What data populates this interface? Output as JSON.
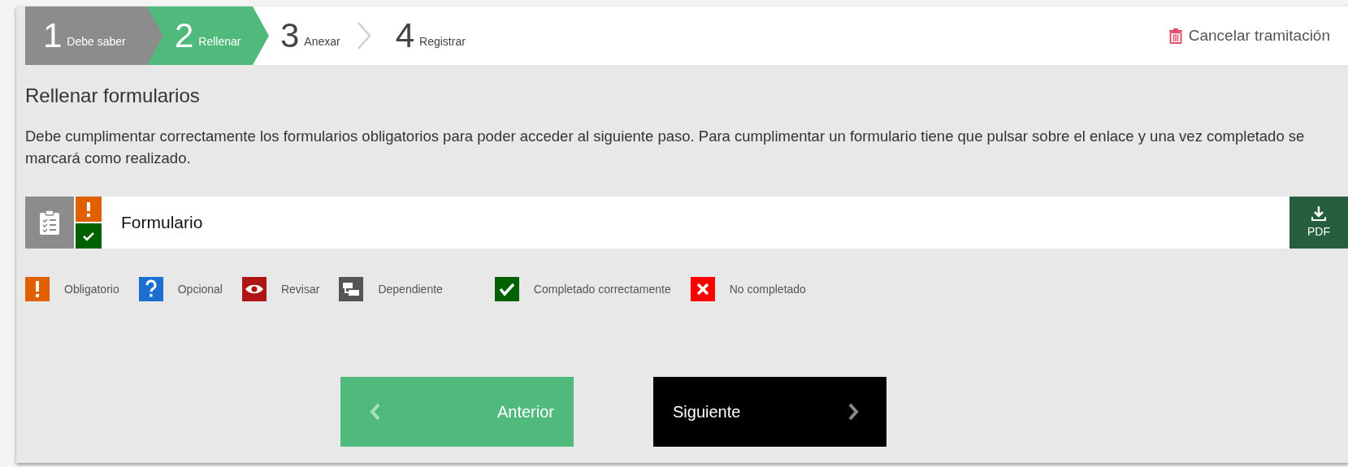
{
  "steps": [
    {
      "number": "1",
      "label": "Debe saber",
      "completed": true,
      "selected": false
    },
    {
      "number": "2",
      "label": "Rellenar",
      "completed": false,
      "selected": true
    },
    {
      "number": "3",
      "label": "Anexar",
      "completed": false,
      "selected": false
    },
    {
      "number": "4",
      "label": "Registrar",
      "completed": false,
      "selected": false
    }
  ],
  "cancel_link": "Cancelar tramitación",
  "heading": "Rellenar formularios",
  "description": "Debe cumplimentar correctamente los formularios obligatorios para poder acceder al siguiente paso. Para cumplimentar un formulario tiene que pulsar sobre el enlace y una vez completado se marcará como realizado.",
  "form": {
    "title": "Formulario",
    "required": true,
    "completed": true,
    "pdf_label": "PDF"
  },
  "legend": [
    {
      "kind": "required",
      "label": "Obligatorio",
      "color": "#e06000"
    },
    {
      "kind": "optional",
      "label": "Opcional",
      "color": "#1a6fd0"
    },
    {
      "kind": "review",
      "label": "Revisar",
      "color": "#b01515"
    },
    {
      "kind": "dependent",
      "label": "Dependiente",
      "color": "#555555"
    },
    {
      "kind": "completed",
      "label": "Completado correctamente",
      "color": "#006100"
    },
    {
      "kind": "not-completed",
      "label": "No completado",
      "color": "#ff0000"
    }
  ],
  "buttons": {
    "previous": "Anterior",
    "next": "Siguiente"
  }
}
